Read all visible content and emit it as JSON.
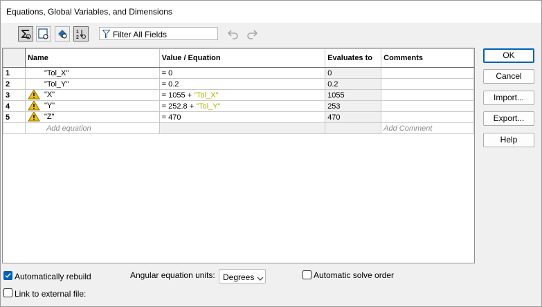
{
  "window": {
    "title": "Equations, Global Variables, and Dimensions"
  },
  "toolbar": {
    "icons": [
      "sigma-view-icon",
      "sheet-view-icon",
      "dimension-view-icon",
      "ordered-view-icon"
    ],
    "filter_label": "Filter All Fields",
    "undo_icon": "undo-icon",
    "redo_icon": "redo-icon"
  },
  "grid": {
    "columns": [
      "Name",
      "Value / Equation",
      "Evaluates to",
      "Comments"
    ],
    "rows": [
      {
        "num": "1",
        "warning": false,
        "name": "\"Tol_X\"",
        "value": "= 0",
        "ref": "",
        "evaluates": "0",
        "comment": ""
      },
      {
        "num": "2",
        "warning": false,
        "name": "\"Tol_Y\"",
        "value": "= 0.2",
        "ref": "",
        "evaluates": "0.2",
        "comment": ""
      },
      {
        "num": "3",
        "warning": true,
        "name": "\"X\"",
        "value": "= 1055 + ",
        "ref": "\"Tol_X\"",
        "evaluates": "1055",
        "comment": ""
      },
      {
        "num": "4",
        "warning": true,
        "name": "\"Y\"",
        "value": "= 252.8 + ",
        "ref": "\"Tol_Y\"",
        "evaluates": "253",
        "comment": ""
      },
      {
        "num": "5",
        "warning": true,
        "name": "\"Z\"",
        "value": "= 470",
        "ref": "",
        "evaluates": "470",
        "comment": ""
      }
    ],
    "add_equation_placeholder": "Add equation",
    "add_comment_placeholder": "Add Comment"
  },
  "buttons": {
    "ok": "OK",
    "cancel": "Cancel",
    "import": "Import...",
    "export": "Export...",
    "help": "Help"
  },
  "footer": {
    "auto_rebuild_label": "Automatically rebuild",
    "auto_rebuild_checked": true,
    "angular_units_label": "Angular equation units:",
    "angular_units_value": "Degrees",
    "auto_solve_label": "Automatic solve order",
    "auto_solve_checked": false,
    "link_external_label": "Link to external file:",
    "link_external_checked": false
  },
  "colors": {
    "accent": "#005fb8",
    "reference_text": "#b2b200",
    "warning": "#f2c200"
  }
}
